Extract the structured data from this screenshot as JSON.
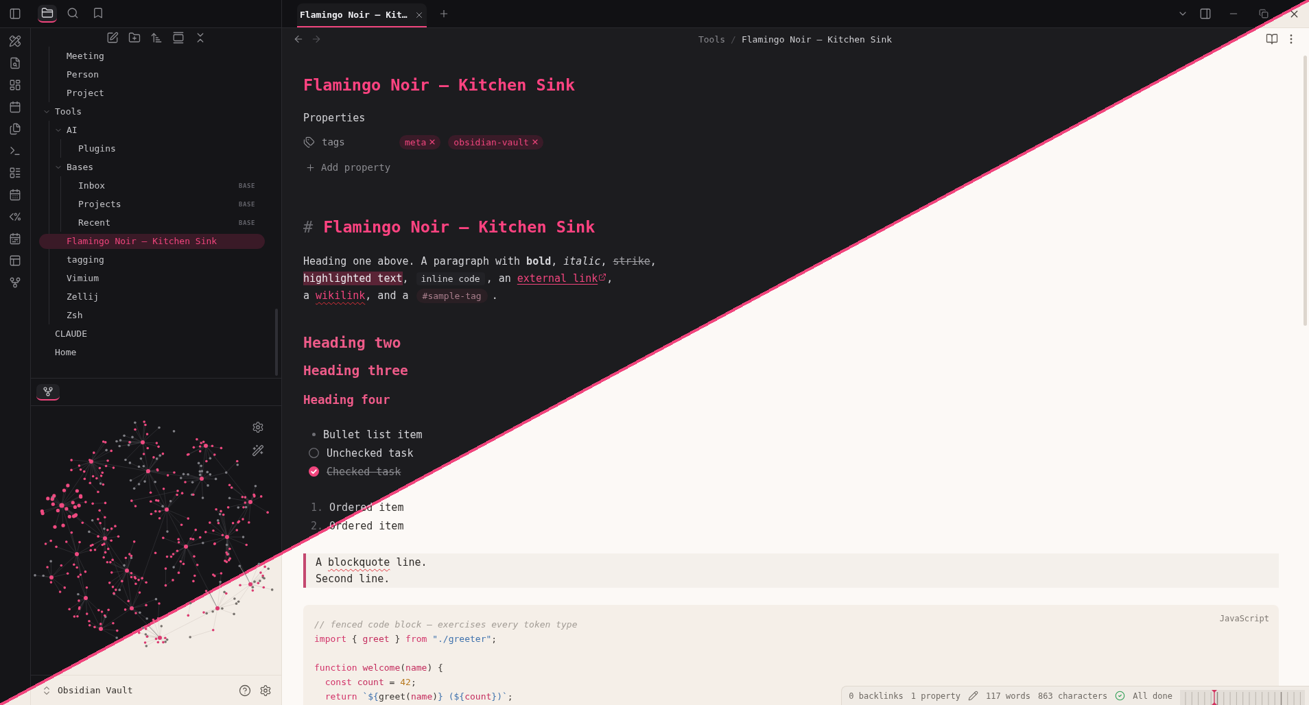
{
  "left_title": {
    "sidebar_tabs": [
      {
        "selected": true
      },
      {
        "selected": false
      },
      {
        "selected": false
      }
    ]
  },
  "file_tree": [
    {
      "kind": "continued",
      "children": [
        {
          "kind": "file",
          "label": "Meeting",
          "selected": false
        },
        {
          "kind": "file",
          "label": "Person",
          "selected": false
        },
        {
          "kind": "file",
          "label": "Project",
          "selected": false
        }
      ]
    },
    {
      "kind": "folder",
      "label": "Tools",
      "expanded": true,
      "children": [
        {
          "kind": "folder",
          "label": "AI",
          "expanded": true,
          "children": [
            {
              "kind": "file",
              "label": "Plugins",
              "selected": false
            }
          ]
        },
        {
          "kind": "folder",
          "label": "Bases",
          "expanded": true,
          "children": [
            {
              "kind": "file",
              "label": "Inbox",
              "badge": "BASE",
              "selected": false
            },
            {
              "kind": "file",
              "label": "Projects",
              "badge": "BASE",
              "selected": false
            },
            {
              "kind": "file",
              "label": "Recent",
              "badge": "BASE",
              "selected": false
            }
          ]
        },
        {
          "kind": "file",
          "label": "Flamingo Noir — Kitchen Sink",
          "selected": true
        },
        {
          "kind": "file",
          "label": "tagging",
          "selected": false
        },
        {
          "kind": "file",
          "label": "Vimium",
          "selected": false
        },
        {
          "kind": "file",
          "label": "Zellij",
          "selected": false
        },
        {
          "kind": "file",
          "label": "Zsh",
          "selected": false
        }
      ]
    },
    {
      "kind": "file",
      "label": "CLAUDE",
      "selected": false
    },
    {
      "kind": "file",
      "label": "Home",
      "selected": false
    }
  ],
  "graph_tabs": [
    {
      "selected": true
    }
  ],
  "vault_name": "Obsidian Vault",
  "editor_tabs": [
    {
      "label": "Flamingo Noir — Kit…",
      "selected": true
    }
  ],
  "breadcrumb": {
    "items": [
      "Tools",
      "Flamingo Noir — Kitchen Sink"
    ],
    "separator": "/"
  },
  "note": {
    "title": "Flamingo Noir — Kitchen Sink",
    "properties": {
      "heading": "Properties",
      "rows": [
        {
          "key": "tags",
          "values": [
            "meta",
            "obsidian-vault"
          ]
        }
      ],
      "add_label": "Add property"
    },
    "h1": {
      "marker": "#",
      "text": "Flamingo Noir — Kitchen Sink"
    },
    "paragraph": [
      [
        {
          "kind": "text",
          "text": "Heading one above. A paragraph with **bold**, *italic*, "
        },
        {
          "kind": "strike",
          "text": "strike"
        },
        {
          "kind": "text",
          "text": ","
        }
      ],
      [
        {
          "kind": "highlight",
          "text": "highlighted text"
        },
        {
          "kind": "text",
          "text": ", "
        },
        {
          "kind": "code",
          "text": "inline code"
        },
        {
          "kind": "text",
          "text": ", an "
        },
        {
          "kind": "link",
          "text": "external link"
        },
        {
          "kind": "text",
          "text": ","
        }
      ],
      [
        {
          "kind": "text",
          "text": "a "
        },
        {
          "kind": "wikilink",
          "text": "wikilink",
          "misspelled": true
        },
        {
          "kind": "text",
          "text": ", and a "
        },
        {
          "kind": "tag",
          "text": "#sample-tag"
        },
        {
          "kind": "text",
          "text": "."
        }
      ]
    ],
    "headings": [
      {
        "kind": "h2",
        "text": "Heading two"
      },
      {
        "kind": "h3",
        "text": "Heading three"
      },
      {
        "kind": "h4",
        "text": "Heading four"
      }
    ],
    "bullet_list": [
      "Bullet list item"
    ],
    "task_list": [
      {
        "text": "Unchecked task",
        "checked": false
      },
      {
        "text": "Checked task",
        "checked": true
      }
    ],
    "ordered_list": [
      {
        "number": "1.",
        "text": "Ordered item"
      },
      {
        "number": "2.",
        "text": "Ordered item"
      }
    ],
    "blockquote": [
      [
        {
          "kind": "text",
          "text": "A "
        },
        {
          "kind": "misspelled",
          "text": "blockquote"
        },
        {
          "kind": "text",
          "text": " line."
        }
      ],
      [
        {
          "kind": "text",
          "text": "Second line."
        }
      ]
    ],
    "code_block": {
      "language": "JavaScript",
      "lines": [
        {
          "kind": "code",
          "tokens": [
            {
              "kind": "comment",
              "text": "// fenced code block — exercises every token type"
            }
          ]
        },
        {
          "kind": "code",
          "tokens": [
            {
              "kind": "keyword",
              "text": "import"
            },
            {
              "kind": "plain",
              "text": " { "
            },
            {
              "kind": "def",
              "text": "greet"
            },
            {
              "kind": "plain",
              "text": " } "
            },
            {
              "kind": "keyword",
              "text": "from"
            },
            {
              "kind": "string",
              "text": " \"./greeter\""
            },
            {
              "kind": "plain",
              "text": ";"
            }
          ]
        },
        {
          "kind": "blank"
        },
        {
          "kind": "code",
          "tokens": [
            {
              "kind": "keyword",
              "text": "function "
            },
            {
              "kind": "def",
              "text": "welcome"
            },
            {
              "kind": "plain",
              "text": "("
            },
            {
              "kind": "def",
              "text": "name"
            },
            {
              "kind": "plain",
              "text": ") {"
            }
          ]
        },
        {
          "kind": "code",
          "tokens": [
            {
              "kind": "keyword",
              "text": "  const "
            },
            {
              "kind": "def",
              "text": "count"
            },
            {
              "kind": "plain",
              "text": " = "
            },
            {
              "kind": "number",
              "text": "42"
            },
            {
              "kind": "plain",
              "text": ";"
            }
          ]
        },
        {
          "kind": "code",
          "tokens": [
            {
              "kind": "keyword",
              "text": "  return "
            },
            {
              "kind": "string",
              "text": "`${"
            },
            {
              "kind": "plain",
              "text": "greet("
            },
            {
              "kind": "def",
              "text": "name"
            },
            {
              "kind": "plain",
              "text": ")"
            },
            {
              "kind": "string",
              "text": "} (${"
            },
            {
              "kind": "def",
              "text": "count"
            },
            {
              "kind": "string",
              "text": "})`"
            },
            {
              "kind": "plain",
              "text": ";"
            }
          ]
        }
      ]
    }
  },
  "status_bar": {
    "backlinks": "0 backlinks",
    "properties": "1 property",
    "words": "117 words",
    "characters": "863 characters",
    "sync": "All done"
  }
}
